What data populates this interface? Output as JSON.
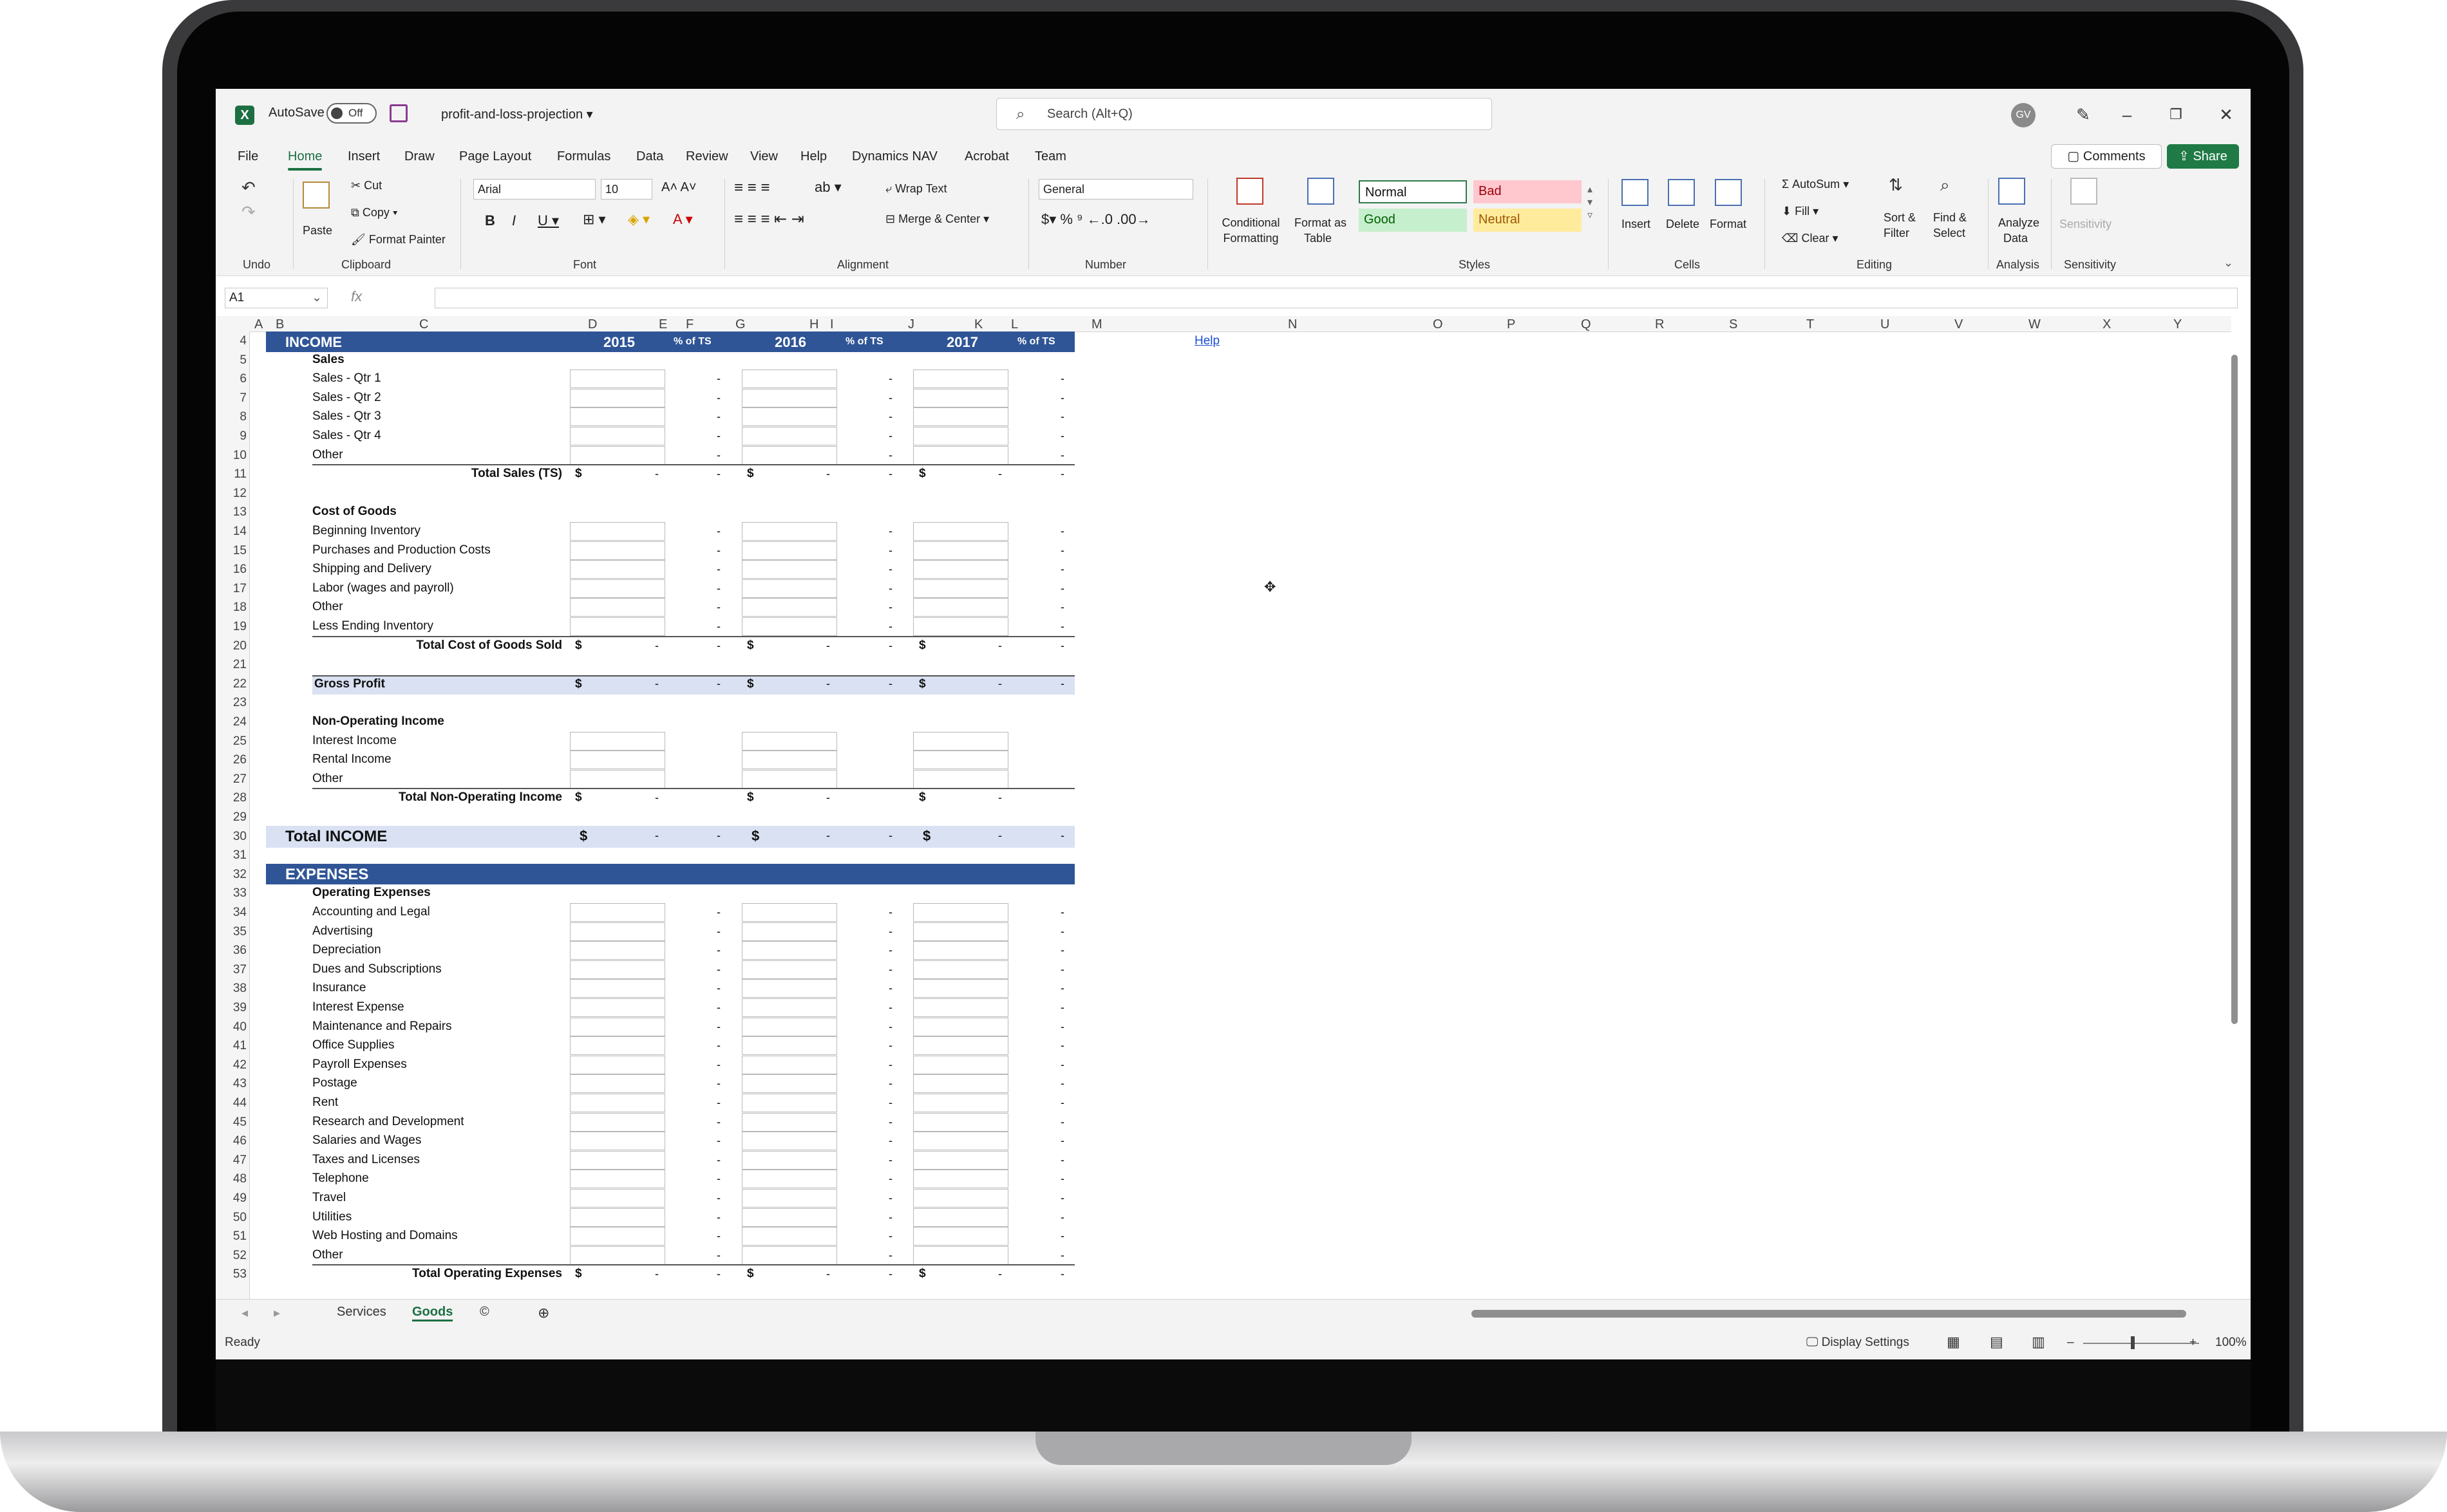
{
  "titlebar": {
    "autosave_label": "AutoSave",
    "autosave_state": "Off",
    "document_title": "profit-and-loss-projection",
    "search_placeholder": "Search (Alt+Q)",
    "avatar_initials": "GV"
  },
  "menu": {
    "tabs": [
      "File",
      "Home",
      "Insert",
      "Draw",
      "Page Layout",
      "Formulas",
      "Data",
      "Review",
      "View",
      "Help",
      "Dynamics NAV",
      "Acrobat",
      "Team"
    ],
    "active_tab": "Home",
    "comments_label": "Comments",
    "share_label": "Share"
  },
  "ribbon": {
    "groups": [
      "Undo",
      "Clipboard",
      "Font",
      "Alignment",
      "Number",
      "Styles",
      "Cells",
      "Editing",
      "Analysis",
      "Sensitivity"
    ],
    "paste": "Paste",
    "cut": "Cut",
    "copy": "Copy",
    "format_painter": "Format Painter",
    "font_name": "Arial",
    "font_size": "10",
    "wrap_text": "Wrap Text",
    "merge_center": "Merge & Center",
    "number_format": "General",
    "conditional_formatting": [
      "Conditional",
      "Formatting"
    ],
    "format_as_table": [
      "Format as",
      "Table"
    ],
    "styles": {
      "normal": "Normal",
      "bad": "Bad",
      "good": "Good",
      "neutral": "Neutral"
    },
    "insert": "Insert",
    "delete": "Delete",
    "format": "Format",
    "autosum": "AutoSum",
    "fill": "Fill",
    "clear": "Clear",
    "sort_filter": [
      "Sort &",
      "Filter"
    ],
    "find_select": [
      "Find &",
      "Select"
    ],
    "analyze_data": [
      "Analyze",
      "Data"
    ],
    "sensitivity": "Sensitivity"
  },
  "formula_bar": {
    "name_box": "A1",
    "fx": "fx"
  },
  "columns": [
    "A",
    "B",
    "C",
    "D",
    "E",
    "F",
    "G",
    "H",
    "I",
    "J",
    "K",
    "L",
    "M",
    "N",
    "O",
    "P",
    "Q",
    "R",
    "S",
    "T",
    "U",
    "V",
    "W",
    "X",
    "Y"
  ],
  "sheet": {
    "income_header": "INCOME",
    "years": [
      "2015",
      "2016",
      "2017"
    ],
    "pct_label": "% of TS",
    "help_link": "Help",
    "sales_title": "Sales",
    "sales_items": [
      "Sales - Qtr 1",
      "Sales - Qtr 2",
      "Sales - Qtr 3",
      "Sales - Qtr 4",
      "Other"
    ],
    "total_sales": "Total Sales (TS)",
    "cogs_title": "Cost of Goods",
    "cogs_items": [
      "Beginning Inventory",
      "Purchases and Production Costs",
      "Shipping and Delivery",
      "Labor (wages and payroll)",
      "Other",
      "Less Ending Inventory"
    ],
    "total_cogs": "Total Cost of Goods Sold",
    "gross_profit": "Gross Profit",
    "nonop_title": "Non-Operating Income",
    "nonop_items": [
      "Interest Income",
      "Rental Income",
      "Other"
    ],
    "total_nonop": "Total Non-Operating Income",
    "total_income": "Total INCOME",
    "expenses_header": "EXPENSES",
    "opex_title": "Operating Expenses",
    "opex_items": [
      "Accounting and Legal",
      "Advertising",
      "Depreciation",
      "Dues and Subscriptions",
      "Insurance",
      "Interest Expense",
      "Maintenance and Repairs",
      "Office Supplies",
      "Payroll Expenses",
      "Postage",
      "Rent",
      "Research and Development",
      "Salaries and Wages",
      "Taxes and Licenses",
      "Telephone",
      "Travel",
      "Utilities",
      "Web Hosting and Domains",
      "Other"
    ],
    "total_opex": "Total Operating Expenses",
    "currency": "$",
    "dash": "-"
  },
  "sheet_tabs": {
    "tabs": [
      "Services",
      "Goods",
      "©"
    ],
    "active": "Goods"
  },
  "status": {
    "ready": "Ready",
    "display_settings": "Display Settings",
    "zoom": "100%"
  }
}
